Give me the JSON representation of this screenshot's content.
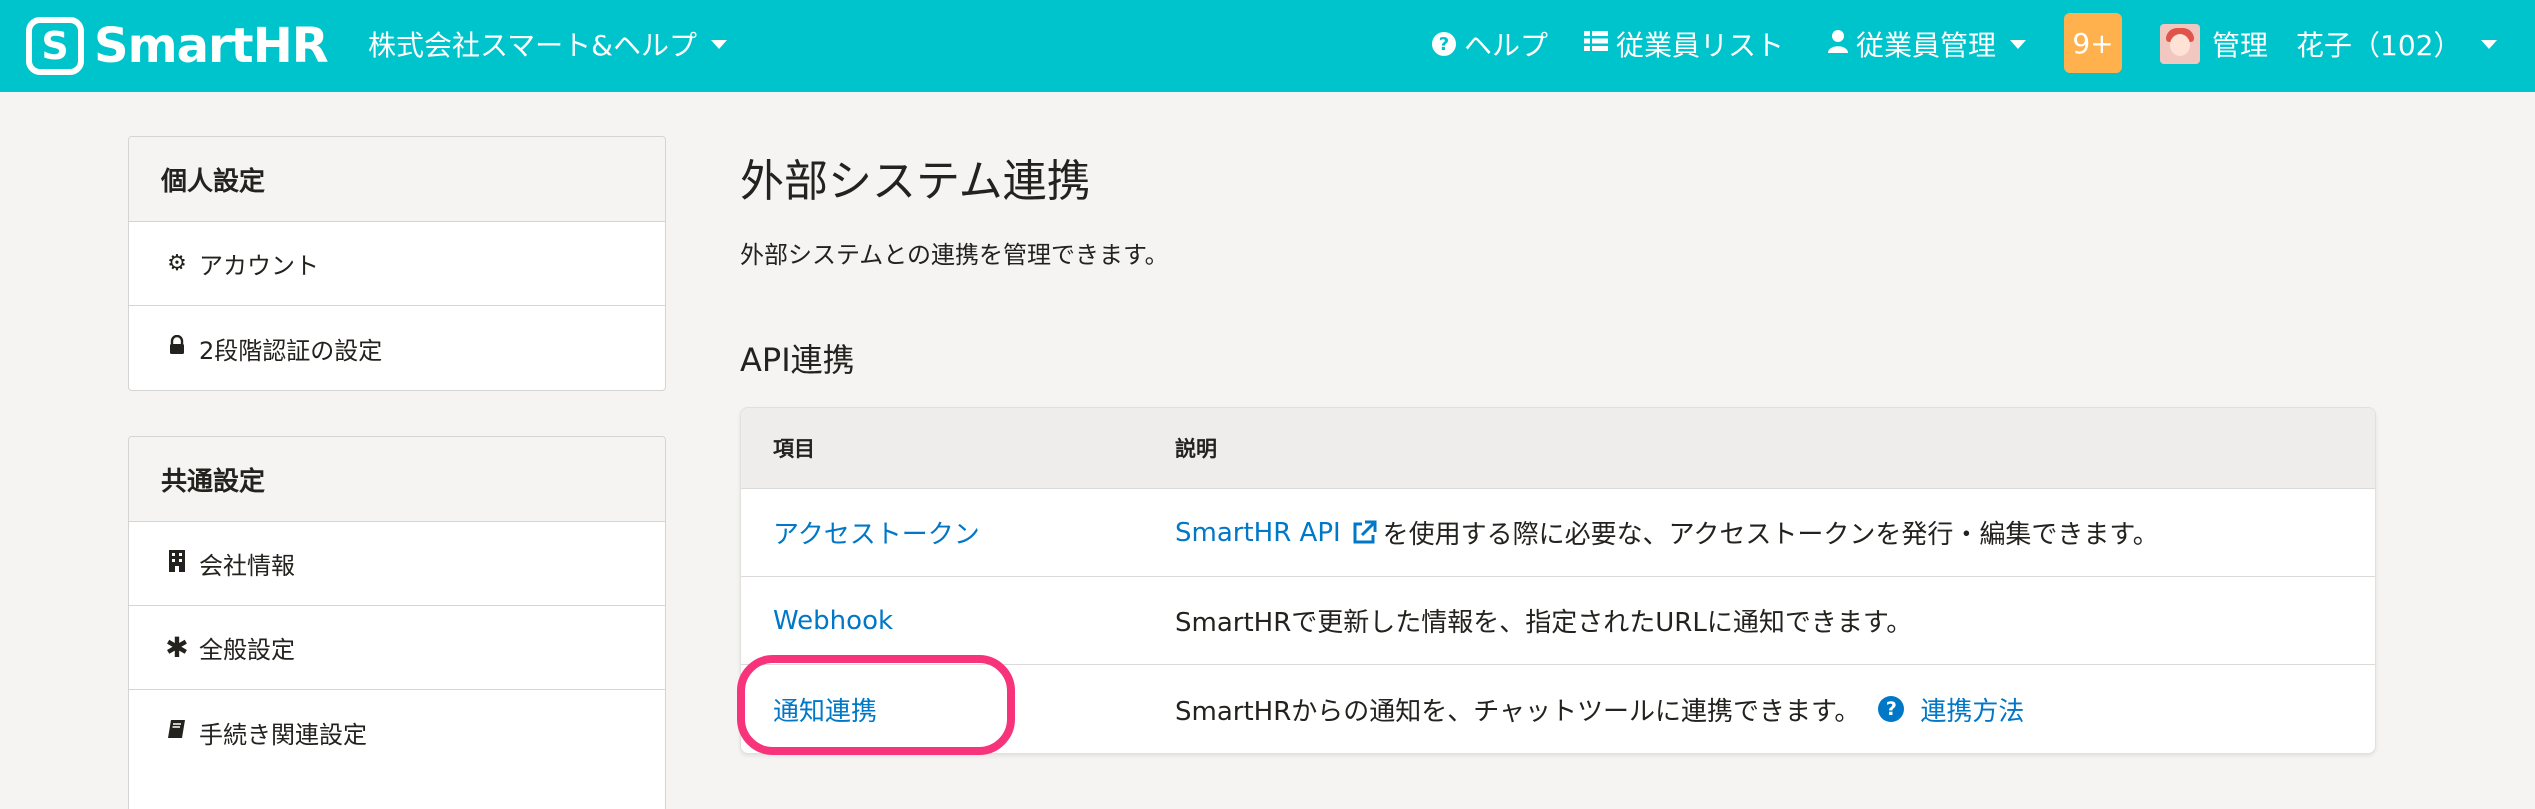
{
  "header": {
    "logo_mark": "S",
    "logo_text": "SmartHR",
    "company": "株式会社スマート&ヘルプ",
    "help": "ヘルプ",
    "employee_list": "従業員リスト",
    "employee_management": "従業員管理",
    "notification_count": "9+",
    "user": "管理　花子（102）"
  },
  "sidebar": {
    "personal": {
      "title": "個人設定",
      "items": [
        {
          "label": "アカウント",
          "icon": "gear-icon"
        },
        {
          "label": "2段階認証の設定",
          "icon": "lock-icon"
        }
      ]
    },
    "common": {
      "title": "共通設定",
      "items": [
        {
          "label": "会社情報",
          "icon": "building-icon"
        },
        {
          "label": "全般設定",
          "icon": "asterisk-icon"
        },
        {
          "label": "手続き関連設定",
          "icon": "book-icon"
        }
      ]
    }
  },
  "main": {
    "title": "外部システム連携",
    "description": "外部システムとの連携を管理できます。",
    "section_title": "API連携",
    "table": {
      "headers": [
        "項目",
        "説明"
      ],
      "rows": [
        {
          "item": "アクセストークン",
          "link": "SmartHR API",
          "text": "を使用する際に必要な、アクセストークンを発行・編集できます。"
        },
        {
          "item": "Webhook",
          "text": "SmartHRで更新した情報を、指定されたURLに通知できます。"
        },
        {
          "item": "通知連携",
          "text": "SmartHRからの通知を、チャットツールに連携できます。",
          "help_link": "連携方法"
        }
      ]
    }
  },
  "colors": {
    "header": "#00c4cc",
    "link": "#0077c7",
    "badge": "#ffb14e",
    "highlight": "#f7337b"
  }
}
